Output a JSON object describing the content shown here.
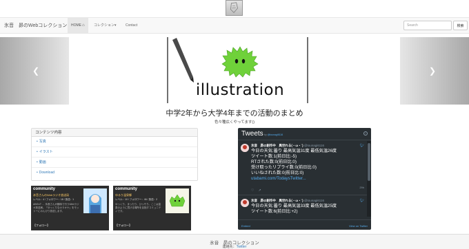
{
  "navbar": {
    "brand": "氷音　昴のWebコレクション",
    "home": "HOME",
    "collection": "コレクション▾",
    "contact": "Contact",
    "search_placeholder": "Search",
    "search_button": "検索"
  },
  "hero": {
    "slide_title": "illustration",
    "caption_main": "中学2年から大学4年までの活動のまとめ",
    "caption_sub": "色々種広くやってます()"
  },
  "contents_panel": {
    "heading": "コンテンツ内容",
    "items": [
      "写真",
      "イラスト",
      "動画",
      "Download"
    ]
  },
  "communities": [
    {
      "title": "community",
      "name": "氷音さんのWebラジオ放送局",
      "stats": "レベル：4 / フォロワー：18 / 放送：1",
      "desc": "ABOUT … 氷音さんが趣味で行うWebラジオ放送局。「ゆっくりなカラオケ」をモットーにのんびり放送します。",
      "follow": "【フォロー】"
    },
    {
      "title": "community",
      "name": "ゆるり温泉郷",
      "stats": "レベル：10 / フォロワー：46 / 放送：2",
      "desc": "ゆっくり、まったり、ひっそり。ここは温泉のように寛げる場所を目指すコミュニティです。",
      "follow": "【フォロー】"
    }
  ],
  "tweets": {
    "title": "Tweets",
    "by_prefix": "by",
    "by_handle": "@tounagi6116",
    "tweet1": {
      "user": "氷音　昴@創作中　異世れる(・ω・`)",
      "handle": "@tounagi6116",
      "lines": [
        "今日の天気:曇り 最高気温31度 最低気温26度",
        "ツイート数:1(前日比:-5)",
        "RTされた数:0(前日比:0)",
        "受け取ったリプライ数:0(前日比:0)",
        "いいねされた数:0(前日比:0)"
      ],
      "link": "utabami.com/TodaysTwitter...",
      "time": "29h"
    },
    "tweet2": {
      "user": "氷音　昴@創作中　異世れる(・ω・`)",
      "handle": "@tounagi6116",
      "lines": [
        "今日の天気:曇り 最高気温33度 最低気温25度",
        "ツイート数:6(前日比:+2)"
      ]
    },
    "embed": "Embed",
    "view_on": "View on Twitter"
  },
  "footer": {
    "line1": "氷音　昴のコレクション",
    "contact_label": "連絡先：",
    "contact_link": "Twitter"
  }
}
